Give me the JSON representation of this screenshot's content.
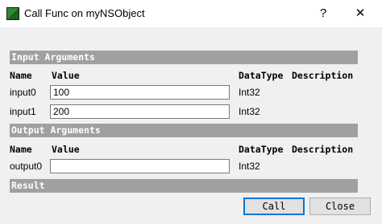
{
  "window": {
    "title": "Call Func on myNSObject",
    "help_glyph": "?",
    "close_glyph": "✕",
    "icon": "green-dark-square-app-icon"
  },
  "input_section": {
    "title": "Input Arguments",
    "headers": {
      "name": "Name",
      "value": "Value",
      "datatype": "DataType",
      "description": "Description"
    },
    "rows": [
      {
        "name": "input0",
        "value": "100",
        "datatype": "Int32"
      },
      {
        "name": "input1",
        "value": "200",
        "datatype": "Int32"
      }
    ]
  },
  "output_section": {
    "title": "Output Arguments",
    "headers": {
      "name": "Name",
      "value": "Value",
      "datatype": "DataType",
      "description": "Description"
    },
    "rows": [
      {
        "name": "output0",
        "value": "",
        "datatype": "Int32"
      }
    ]
  },
  "result_section": {
    "title": "Result"
  },
  "buttons": {
    "call": "Call",
    "close": "Close"
  }
}
